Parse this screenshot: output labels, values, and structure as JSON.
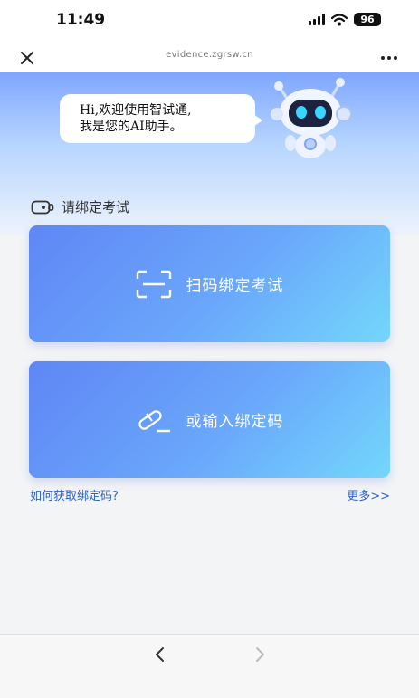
{
  "status_bar": {
    "time": "11:49",
    "battery": "96",
    "icons": [
      "signal-icon",
      "wifi-icon",
      "battery-icon"
    ]
  },
  "nav_bar": {
    "url": "evidence.zgrsw.cn",
    "icons": [
      "close-icon",
      "more-icon"
    ]
  },
  "greeting": {
    "line1": "Hi,欢迎使用智试通,",
    "line2": "我是您的AI助手。"
  },
  "section": {
    "label": "请绑定考试",
    "icon": "camera-icon"
  },
  "actions": {
    "scan_label": "扫码绑定考试",
    "scan_icon": "scan-frame-icon",
    "input_label": "或输入绑定码",
    "input_icon": "pencil-icon"
  },
  "links": {
    "how_to": "如何获取绑定码?",
    "more": "更多>>"
  },
  "bottom_bar": {
    "icons": [
      "back-icon",
      "forward-icon"
    ]
  },
  "colors": {
    "card_start": "#5f86f5",
    "card_end": "#73d7fb",
    "link": "#2b63c9"
  }
}
